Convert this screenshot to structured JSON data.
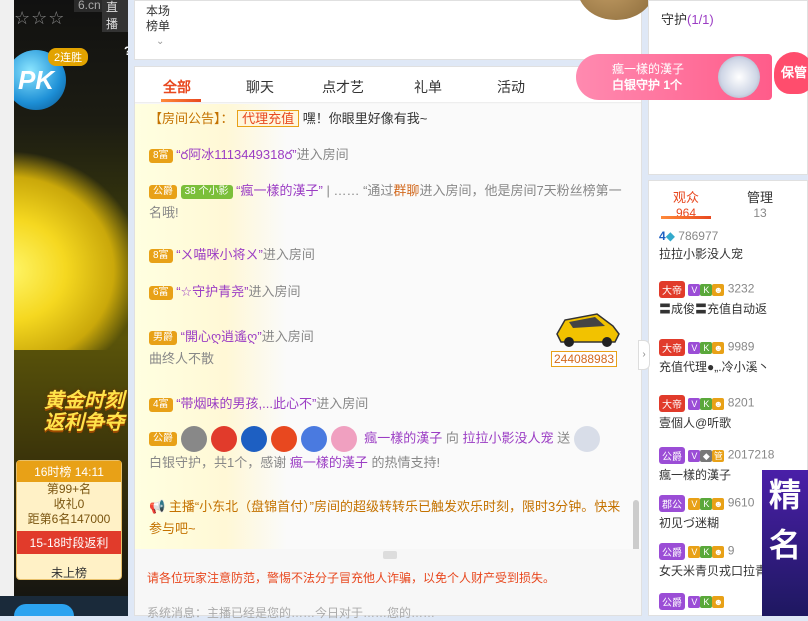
{
  "left": {
    "site_tag": "6.cn",
    "live_tag": "直播",
    "stars": "☆☆☆",
    "pk": "PK",
    "streak": "2连胜",
    "help": "?",
    "promo_line1": "黄金时刻",
    "promo_line2": "返利争夺",
    "rank_head": "16时榜 14:11",
    "rank_line1": "第99+名",
    "rank_line2": "收礼0",
    "rank_line3": "距第6名147000",
    "rank_button": "15-18时段返利",
    "rank_footer": "未上榜"
  },
  "nav": {
    "line1": "本场",
    "line2": "榜单"
  },
  "tabs": [
    "全部",
    "聊天",
    "点才艺",
    "礼单",
    "活动"
  ],
  "announcement": {
    "label": "【房间公告】：",
    "tag": "代理充值",
    "text": "嘿！你眼里好像有我~"
  },
  "messages": [
    {
      "badge": "8富",
      "name": "“ర阿冰1113449318ర”",
      "action": "进入房间"
    },
    {
      "badge": "公爵",
      "badge2": "38 个小影",
      "name": "“瘋一樣的漢子”",
      "extra": "| ……",
      "text": "“通过",
      "link": "群聊",
      "text2": "进入房间，他是房间7天粉丝榜第一名哦!"
    },
    {
      "badge": "8富",
      "name": "“ㄨ喵咪小将ㄨ”",
      "action": "进入房间"
    },
    {
      "badge": "6富",
      "name": "“☆守护青尧”",
      "action": "进入房间"
    },
    {
      "badge": "男爵",
      "name": "“開心ღ逍遙ღ”",
      "action": "进入房间",
      "sub": "曲终人不散",
      "car_number": "244088983"
    },
    {
      "badge": "4富",
      "name": "“带烟味的男孩,...此心不”",
      "action": "进入房间"
    },
    {
      "badge": "公爵",
      "from": "瘋一樣的漢子",
      "mid": "向",
      "to": "拉拉小影没人宠",
      "send": "送",
      "gift": "白银守护，共1个，感谢",
      "from2": "瘋一樣的漢子",
      "thanks": "的热情支持!"
    },
    {
      "label": "主播",
      "text": "“小东北（盘锦首付）”房间的超级转转乐已触发欢乐时刻，限时3分钟。快来参与吧~"
    }
  ],
  "warning": "请各位玩家注意防范，警惕不法分子冒充他人诈骗，以免个人财产受到损失。",
  "system": "系统消息：主播已经是您的……今日对于……您的……",
  "guard": {
    "label": "守护",
    "count": "(1/1)",
    "user": "瘋一樣的漢子",
    "level": "白银守护 1个",
    "heart": "保管"
  },
  "audience": {
    "tab1": "观众",
    "tab1_count": "964",
    "tab2": "管理",
    "tab2_count": "13",
    "users": [
      {
        "rank": "4",
        "num": "786977",
        "name": "拉拉小影没人宠"
      },
      {
        "crown": "大帝",
        "num": "3232",
        "name": "〓成俊〓充值自动返"
      },
      {
        "crown": "大帝",
        "num": "9989",
        "name": "充值代理●„.冷小溪丶"
      },
      {
        "crown": "大帝",
        "num": "8201",
        "name": "壹個人@听歌"
      },
      {
        "crown": "公爵",
        "num": "2017218",
        "name": "瘋一樣的漢子"
      },
      {
        "crown": "郡公",
        "num": "9610",
        "name": "初见づ迷糊"
      },
      {
        "crown": "公爵",
        "num": "9",
        "name": "女夭米青贝戎口拉青"
      },
      {
        "crown": "公爵",
        "num": "",
        "name": ""
      }
    ]
  },
  "side_ad": "精名",
  "colors": {
    "accent": "#e8481f",
    "gold": "#e8a117",
    "purple": "#9b3dc4"
  }
}
